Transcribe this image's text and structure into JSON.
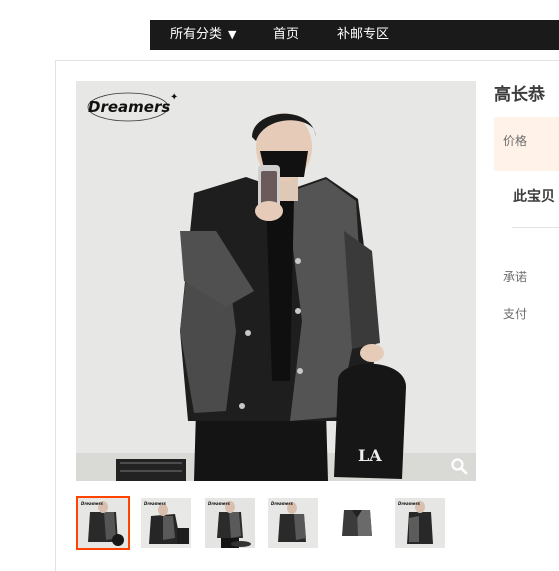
{
  "nav": {
    "items": [
      {
        "label": "所有分类",
        "has_dropdown": true
      },
      {
        "label": "首页"
      },
      {
        "label": "补邮专区"
      }
    ],
    "dropdown_icon": "caret-down-icon"
  },
  "product": {
    "title": "高长恭",
    "price_label": "价格",
    "unavailable_text": "此宝贝",
    "promise_label": "承诺",
    "payment_label": "支付"
  },
  "image": {
    "brand_logo_text": "Dreamers",
    "zoom_icon": "magnifier-icon"
  },
  "thumbnails": {
    "selected_index": 0,
    "items": [
      {
        "name": "thumbnail-1"
      },
      {
        "name": "thumbnail-2"
      },
      {
        "name": "thumbnail-3"
      },
      {
        "name": "thumbnail-4"
      },
      {
        "name": "thumbnail-5"
      },
      {
        "name": "thumbnail-6"
      }
    ]
  },
  "colors": {
    "nav_bg": "#1a1a1a",
    "selected_border": "#ff4400",
    "price_bg": "#fff2e8"
  }
}
